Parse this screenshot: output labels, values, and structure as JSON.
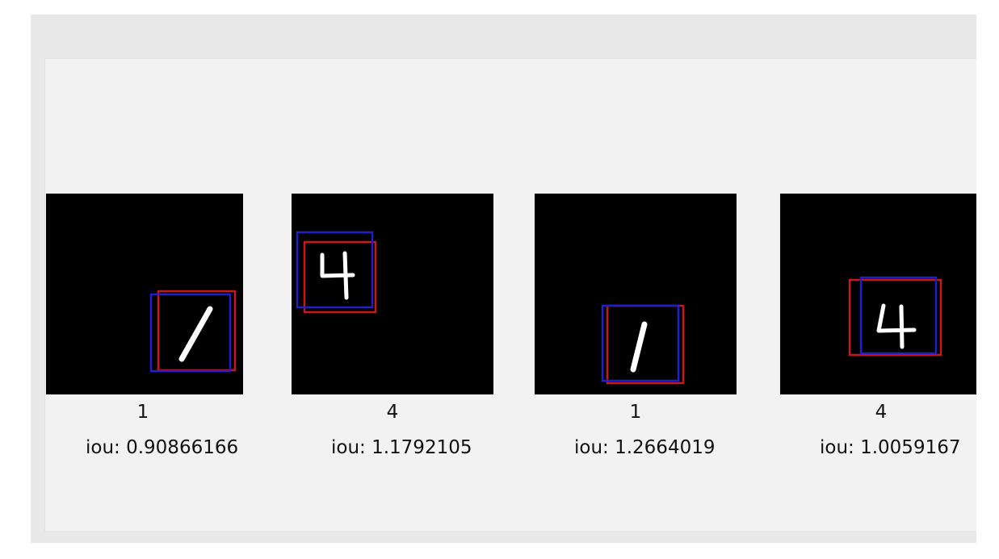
{
  "samples": [
    {
      "label": "1",
      "iou_text": "iou: 0.90866166",
      "digit": "1"
    },
    {
      "label": "4",
      "iou_text": "iou: 1.1792105",
      "digit": "4"
    },
    {
      "label": "1",
      "iou_text": "iou: 1.2664019",
      "digit": "1"
    },
    {
      "label": "4",
      "iou_text": "iou: 1.0059167",
      "digit": "4"
    }
  ],
  "colors": {
    "predicted_box": "#2020c8",
    "ground_truth_box": "#d01818",
    "image_background": "#000000",
    "panel_background": "#f2f2f2"
  }
}
